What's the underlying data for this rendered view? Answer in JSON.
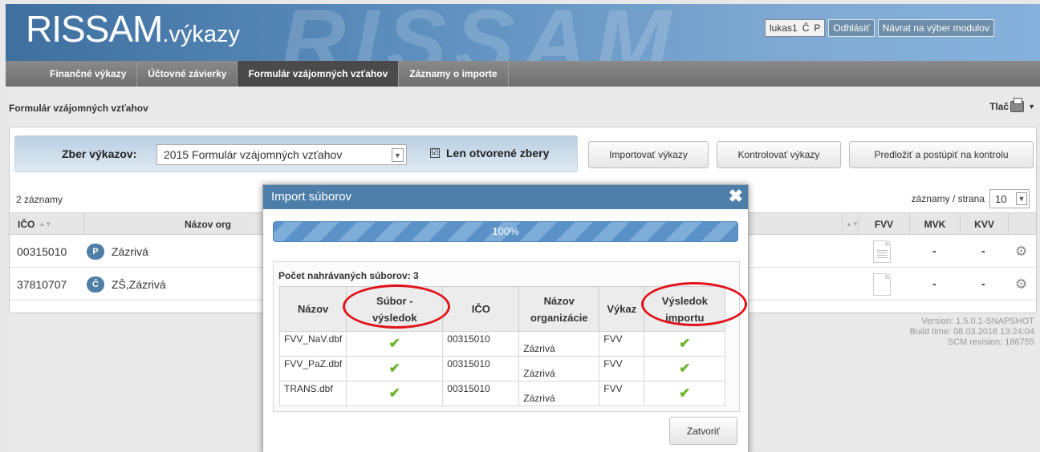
{
  "header": {
    "brand_main": "RISSAM",
    "brand_sub": ".výkazy",
    "watermark": "RISSAM",
    "user": "lukas1",
    "user_c": "Č",
    "user_p": "P",
    "logout": "Odhlásiť",
    "back": "Návrat na výber modulov"
  },
  "nav": {
    "tabs": [
      "Finančné výkazy",
      "Účtovné závierky",
      "Formulár vzájomných vzťahov",
      "Záznamy o importe"
    ]
  },
  "page": {
    "title": "Formulár vzájomných vzťahov",
    "print": "Tlač"
  },
  "filter": {
    "label": "Zber výkazov:",
    "selected": "2015 Formulár vzájomných vzťahov",
    "open_only": "Len otvorené zbery",
    "checked_mark": "☑"
  },
  "actions": [
    "Importovať výkazy",
    "Kontrolovať výkazy",
    "Predložiť a postúpiť na kontrolu"
  ],
  "list": {
    "count": "2 záznamy",
    "per_page_label": "záznamy / strana",
    "per_page": "10",
    "columns": {
      "ico": "IČO",
      "name": "Názov org",
      "fvv": "FVV",
      "mvk": "MVK",
      "kvv": "KVV"
    },
    "rows": [
      {
        "ico": "00315010",
        "badge": "P",
        "name": "Zázrivá",
        "mvk": "-",
        "kvv": "-"
      },
      {
        "ico": "37810707",
        "badge": "Č",
        "name": "ZŠ,Zázrivá",
        "mvk": "-",
        "kvv": "-"
      }
    ]
  },
  "version": {
    "line1": "Version: 1.5.0.1-SNAPSHOT",
    "line2": "Build time: 08.03.2016 13:24:04",
    "line3": "SCM revision: 186755"
  },
  "modal": {
    "title": "Import súborov",
    "progress": "100%",
    "count_label": "Počet nahrávaných súborov: 3",
    "columns": {
      "name": "Názov",
      "file_l1": "Súbor -",
      "file_l2": "výsledok",
      "ico": "IČO",
      "org_l1": "Názov",
      "org_l2": "organizácie",
      "report": "Výkaz",
      "res_l1": "Výsledok",
      "res_l2": "importu"
    },
    "rows": [
      {
        "name": "FVV_NaV.dbf",
        "ico": "00315010",
        "org": "Zázrivá",
        "report": "FVV"
      },
      {
        "name": "FVV_PaZ.dbf",
        "ico": "00315010",
        "org": "Zázrivá",
        "report": "FVV"
      },
      {
        "name": "TRANS.dbf",
        "ico": "00315010",
        "org": "Zázrivá",
        "report": "FVV"
      }
    ],
    "close": "Zatvoriť"
  }
}
